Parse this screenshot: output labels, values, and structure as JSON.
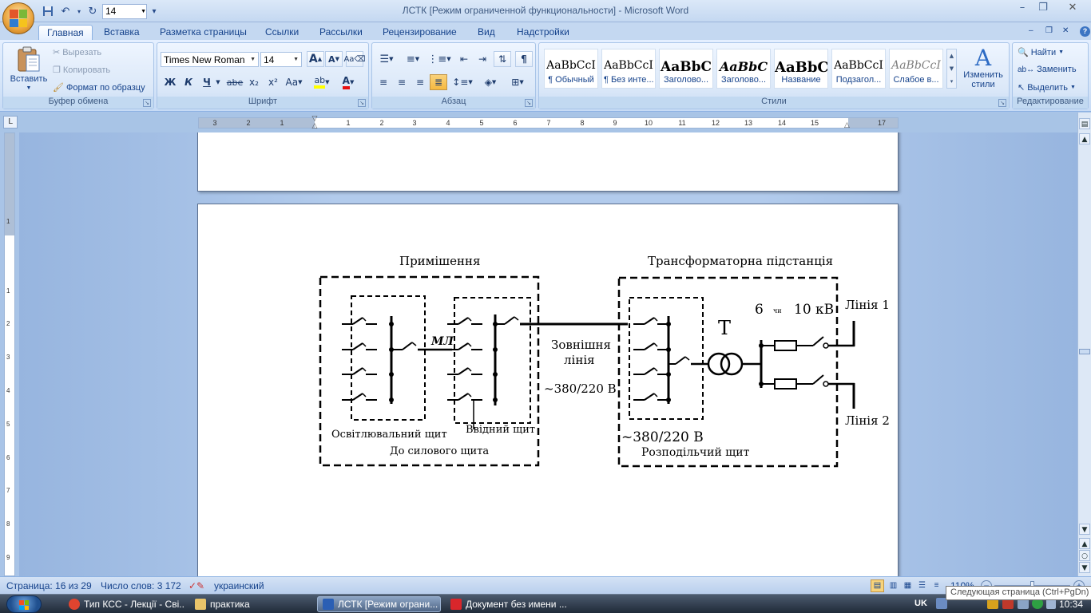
{
  "window": {
    "title": "ЛСТК [Режим ограниченной функциональности] - Microsoft Word",
    "minimize": "–",
    "restore": "❐",
    "close": "✕",
    "ribbon_min": "–",
    "ribbon_restore": "❐",
    "ribbon_close": "✕"
  },
  "qat": {
    "save_icon": "save-icon",
    "undo_icon": "undo-icon",
    "redo_icon": "redo-icon",
    "font_size": "14",
    "customize": "▾"
  },
  "tabs": [
    "Главная",
    "Вставка",
    "Разметка страницы",
    "Ссылки",
    "Рассылки",
    "Рецензирование",
    "Вид",
    "Надстройки"
  ],
  "help": "?",
  "clipboard": {
    "label": "Буфер обмена",
    "paste": "Вставить",
    "cut": "Вырезать",
    "copy": "Копировать",
    "format_painter": "Формат по образцу"
  },
  "font": {
    "label": "Шрифт",
    "family": "Times New Roman",
    "size": "14",
    "grow": "A",
    "shrink": "A",
    "bold": "Ж",
    "italic": "К",
    "underline": "Ч",
    "strike": "abe",
    "subscript": "x₂",
    "superscript": "x²",
    "case": "Aa",
    "highlight": "ab",
    "color": "A"
  },
  "paragraph": {
    "label": "Абзац",
    "pilcrow": "¶"
  },
  "styles": {
    "label": "Стили",
    "items": [
      {
        "sample": "AaBbCcI",
        "name": "¶ Обычный"
      },
      {
        "sample": "AaBbCcI",
        "name": "¶ Без инте..."
      },
      {
        "sample": "AaBbC",
        "name": "Заголово..."
      },
      {
        "sample": "AaBbC",
        "name": "Заголово..."
      },
      {
        "sample": "AaBbC",
        "name": "Название"
      },
      {
        "sample": "AaBbCcI",
        "name": "Подзагол..."
      },
      {
        "sample": "AaBbCcI",
        "name": "Слабое в..."
      }
    ],
    "change_styles": "Изменить стили"
  },
  "editing": {
    "label": "Редактирование",
    "find": "Найти",
    "replace": "Заменить",
    "select": "Выделить"
  },
  "ruler": {
    "corner": "L",
    "ticks": [
      "3",
      "2",
      "1",
      "1",
      "2",
      "3",
      "4",
      "5",
      "6",
      "7",
      "8",
      "9",
      "10",
      "11",
      "12",
      "13",
      "14",
      "15",
      "17"
    ],
    "vticks": [
      "1",
      "1",
      "2",
      "3",
      "4",
      "5",
      "6",
      "7",
      "8",
      "9"
    ]
  },
  "diagram": {
    "room_title": "Примішення",
    "substation_title": "Трансформаторна підстанція",
    "lighting_board": "Освітлювальний щит",
    "input_board": "Ввідний щит",
    "to_power_board": "До силового щита",
    "ml": "МЛ",
    "external_line_1": "Зовнішня",
    "external_line_2": "лінія",
    "voltage_line": "~380/220 В",
    "voltage_dist": "~380/220 В",
    "dist_board": "Розподільчий щит",
    "transformer": "Т",
    "hv_6": "6",
    "hv_or": "чи",
    "hv_10": "10 кВ",
    "line1": "Лінія 1",
    "line2": "Лінія 2"
  },
  "status": {
    "page": "Страница: 16 из 29",
    "words": "Число слов: 3 172",
    "language": "украинский",
    "zoom": "110%"
  },
  "taskbar": {
    "tasks": [
      {
        "label": "Тип КСС - Лекції - Сві...",
        "icon_color": "#e0442f"
      },
      {
        "label": "практика",
        "icon_color": "#e9c46a"
      },
      {
        "label": "ЛСТК [Режим ограни...",
        "icon_color": "#2b5fb4"
      },
      {
        "label": "Документ без имени ...",
        "icon_color": "#d9262b"
      }
    ],
    "lang": "UK",
    "clock": "10:34"
  },
  "tooltip": "Следующая страница (Ctrl+PgDn)",
  "colors": {
    "accent": "#15428b",
    "highlight": "#ffff00",
    "font_color": "#e81010",
    "ribbon": "#dbe8f8"
  }
}
